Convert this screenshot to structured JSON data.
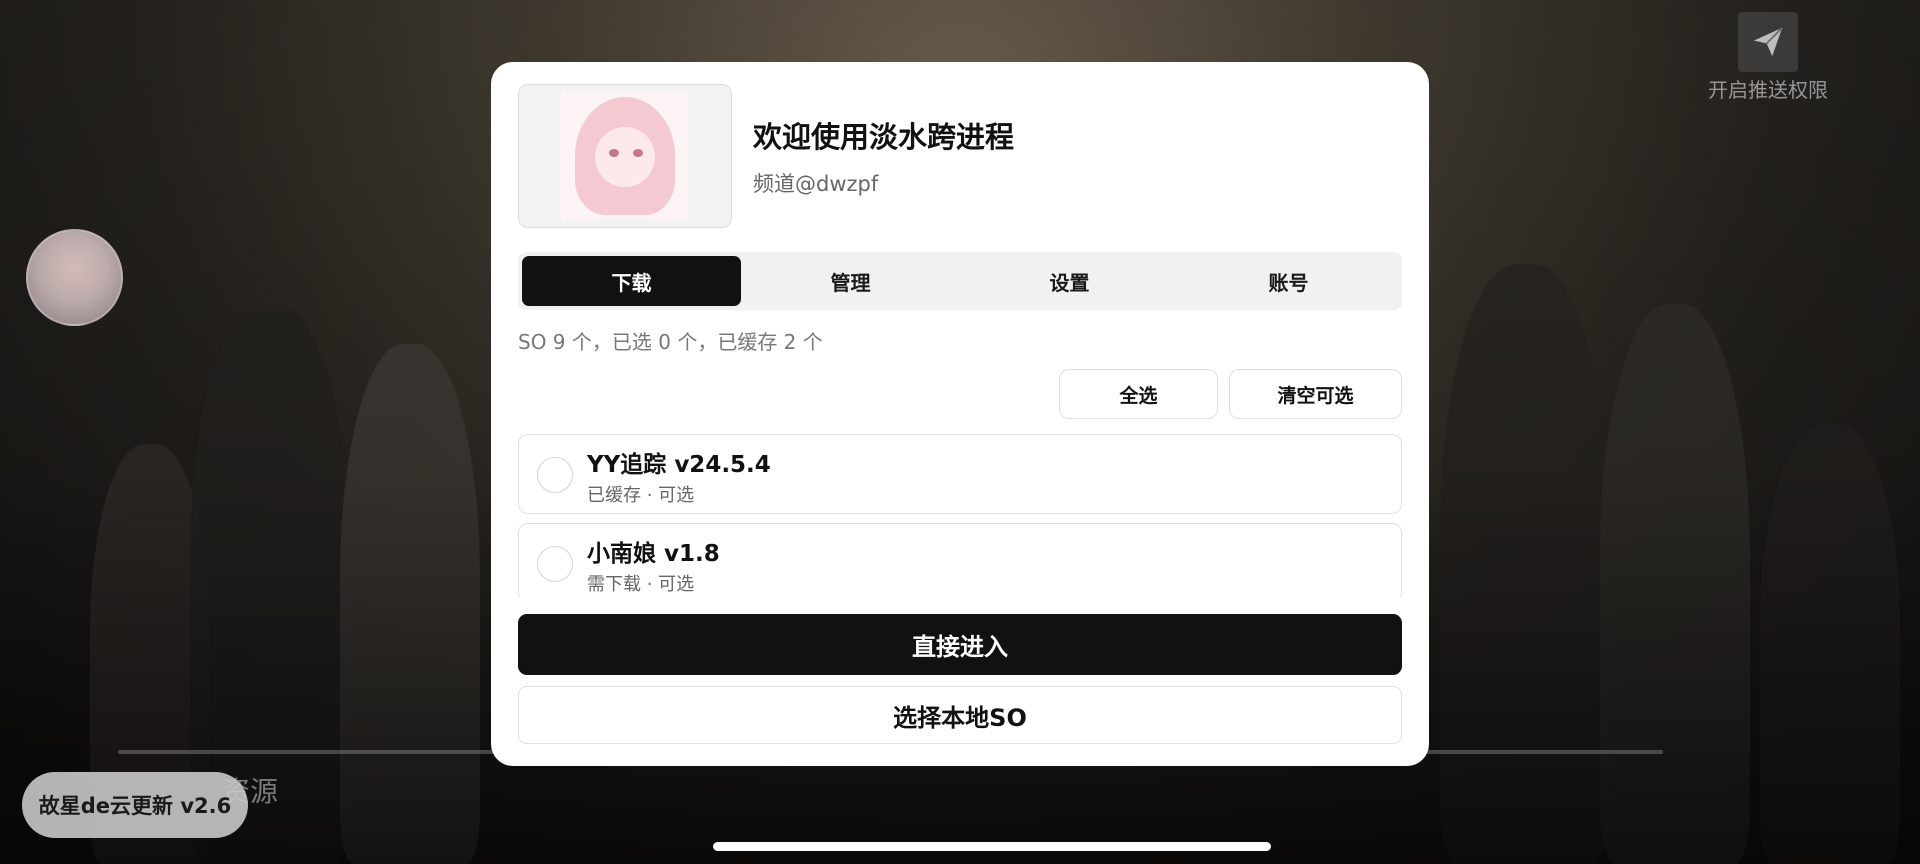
{
  "background": {
    "push_permission_label": "开启推送权限",
    "resource_label": "资源",
    "cloud_update_label": "故星de云更新 v2.6"
  },
  "dialog": {
    "title": "欢迎使用淡水跨进程",
    "channel": "频道@dwzpf",
    "tabs": [
      {
        "label": "下载",
        "active": true
      },
      {
        "label": "管理",
        "active": false
      },
      {
        "label": "设置",
        "active": false
      },
      {
        "label": "账号",
        "active": false
      }
    ],
    "summary": "SO 9 个，已选 0 个，已缓存 2 个",
    "select_all_label": "全选",
    "clear_selectable_label": "清空可选",
    "items": [
      {
        "name": "YY追踪  v24.5.4",
        "status": "已缓存 · 可选",
        "checked": false
      },
      {
        "name": "小南娘  v1.8",
        "status": "需下载 · 可选",
        "checked": false
      }
    ],
    "enter_direct_label": "直接进入",
    "choose_local_label": "选择本地SO"
  },
  "icons": {
    "push": "paper-plane-icon",
    "avatar": "avatar-icon"
  },
  "colors": {
    "primary": "#111111",
    "dialog_bg": "#ffffff",
    "tab_track": "#f1f1f1"
  }
}
